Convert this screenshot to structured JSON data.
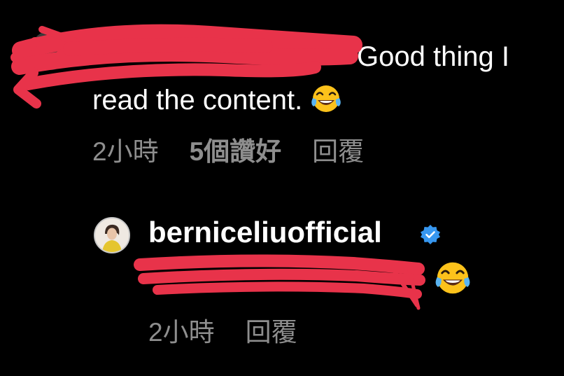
{
  "comment1": {
    "text_line1": "Good thing I",
    "text_line2": "read the content.",
    "emoji": "face-with-tears-of-joy-icon",
    "time": "2小時",
    "likes": "5個讚好",
    "reply": "回覆"
  },
  "comment2": {
    "username": "berniceliuofficial",
    "verified": true,
    "emoji": "face-with-tears-of-joy-icon",
    "time": "2小時",
    "reply": "回覆"
  },
  "colors": {
    "background": "#000000",
    "text": "#ffffff",
    "meta": "#8e8e8e",
    "verified": "#3797f0",
    "redaction": "#e8334a"
  }
}
